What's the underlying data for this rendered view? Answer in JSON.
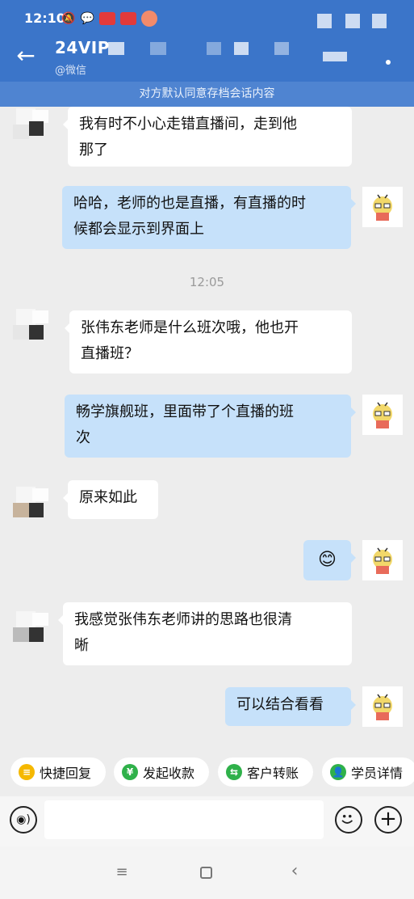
{
  "status_bar": {
    "time": "12:10"
  },
  "header": {
    "title": "24VIP",
    "subtitle": "@微信",
    "notice": "对方默认同意存档会话内容"
  },
  "messages": [
    {
      "side": "left",
      "text_line1": "我有时不小心走错直播间，走到他",
      "text_line2": "那了"
    },
    {
      "side": "right",
      "text_line1": "哈哈，老师的也是直播，有直播的时",
      "text_line2": "候都会显示到界面上"
    },
    {
      "side": "left",
      "text_line1": "张伟东老师是什么班次哦，他也开",
      "text_line2": "直播班？"
    },
    {
      "side": "right",
      "text_line1": "畅学旗舰班，里面带了个直播的班",
      "text_line2": "次"
    },
    {
      "side": "left",
      "text_line1": "原来如此"
    },
    {
      "side": "right",
      "text_line1": "😊"
    },
    {
      "side": "left",
      "text_line1": "我感觉张伟东老师讲的思路也很清",
      "text_line2": "晰"
    },
    {
      "side": "right",
      "text_line1": "可以结合看看"
    }
  ],
  "timestamp": "12:05",
  "quick_actions": [
    {
      "label": "快捷回复",
      "icon": "quick-reply-icon",
      "color": "#f5b800"
    },
    {
      "label": "发起收款",
      "icon": "payment-icon",
      "color": "#2fb14a"
    },
    {
      "label": "客户转账",
      "icon": "transfer-icon",
      "color": "#2fb14a"
    },
    {
      "label": "学员详情",
      "icon": "student-detail-icon",
      "color": "#2fb14a"
    }
  ],
  "input": {
    "placeholder": ""
  }
}
